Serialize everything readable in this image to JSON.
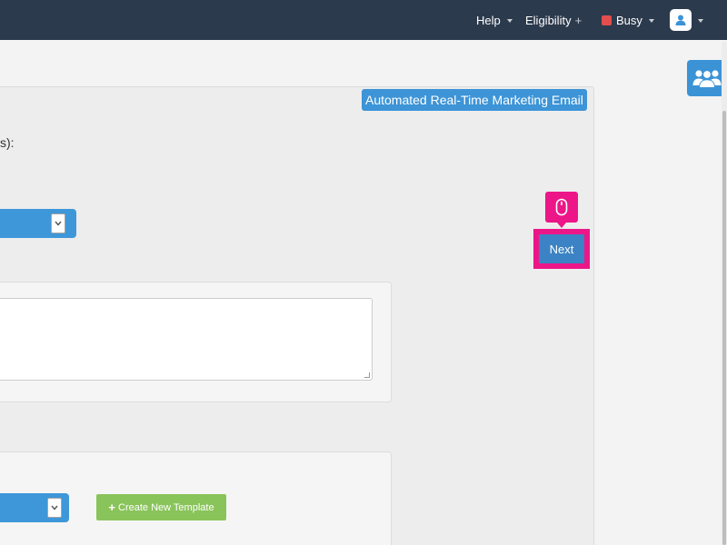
{
  "header": {
    "help_label": "Help",
    "eligibility_label": "Eligibility",
    "status_label": "Busy",
    "colors": {
      "background": "#2c3a4d",
      "status": "#e24e4e"
    }
  },
  "campaign_badge": "Automated Real-Time Marketing Email",
  "clipped_label_fragment": "s):",
  "actions": {
    "next_label": "Next",
    "create_template_label": "Create New Template"
  },
  "colors": {
    "accent": "#3d94d6",
    "highlight": "#ec1688",
    "success": "#89c45a"
  },
  "icons": {
    "side_panel": "users-icon",
    "avatar": "user-icon",
    "pointer": "mouse-icon",
    "create_template": "plus-icon"
  }
}
